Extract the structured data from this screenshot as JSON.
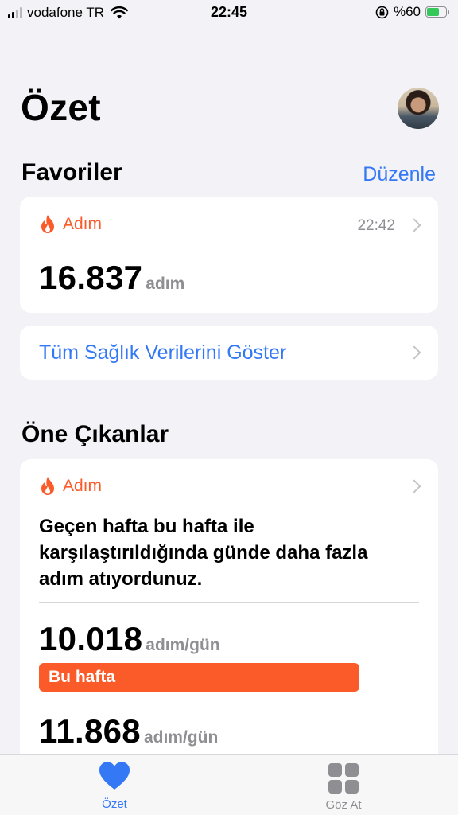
{
  "status_bar": {
    "carrier": "vodafone TR",
    "time": "22:45",
    "battery_percent": "%60",
    "battery_level": 0.6
  },
  "header": {
    "title": "Özet"
  },
  "favorites": {
    "title": "Favoriler",
    "edit_label": "Düzenle",
    "steps_card": {
      "label": "Adım",
      "time": "22:42",
      "value": "16.837",
      "unit": "adım"
    },
    "show_all_label": "Tüm Sağlık Verilerini Göster"
  },
  "highlights": {
    "title": "Öne Çıkanlar",
    "card": {
      "label": "Adım",
      "text": "Geçen hafta bu hafta ile karşılaştırıldığında günde daha fazla adım atıyordunuz.",
      "this_week_value": "10.018",
      "this_week_unit": "adım/gün",
      "this_week_label": "Bu hafta",
      "last_week_value": "11.868",
      "last_week_unit": "adım/gün"
    }
  },
  "tab_bar": {
    "summary_label": "Özet",
    "browse_label": "Göz At"
  },
  "colors": {
    "accent": "#3478f6",
    "steps": "#fb5a29",
    "battery": "#34c759"
  }
}
